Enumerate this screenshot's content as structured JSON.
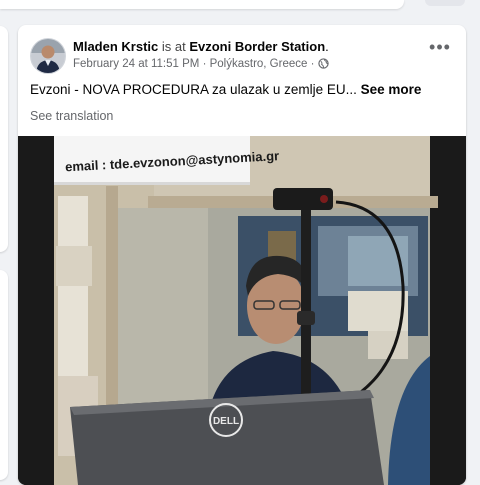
{
  "post": {
    "author": "Mladen Krstic",
    "is_at": "is at",
    "place": "Evzoni Border Station",
    "period": ".",
    "date": "February 24 at 11:51 PM",
    "separator": "·",
    "location": "Polýkastro, Greece",
    "audience_icon": "globe-icon",
    "more_icon": "ellipsis-icon",
    "text": "Evzoni - NOVA PROCEDURA za ulazak u zemlje EU...",
    "see_more": "See more",
    "see_translation": "See translation",
    "photo": {
      "sign_text": "email : tde.evzonon@astynomia.gr",
      "laptop_logo": "DELL"
    }
  },
  "colors": {
    "page_bg": "#f0f2f5",
    "card_bg": "#ffffff",
    "muted_text": "#65676b"
  }
}
